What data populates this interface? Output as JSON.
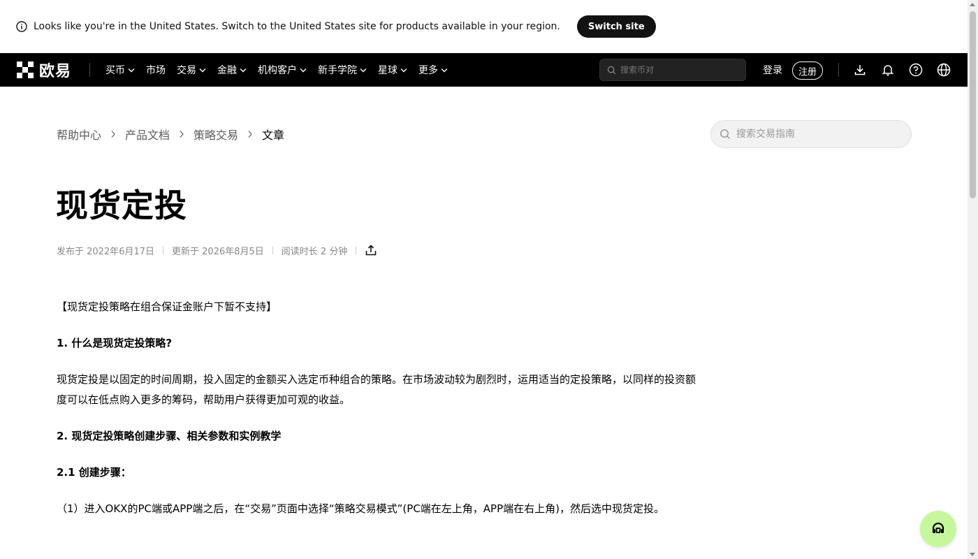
{
  "banner": {
    "message": "Looks like you're in the United States. Switch to the United States site for products available in your region.",
    "switch_label": "Switch site"
  },
  "nav": {
    "brand": "欧易",
    "items": [
      {
        "label": "买币",
        "dropdown": true
      },
      {
        "label": "市场",
        "dropdown": false
      },
      {
        "label": "交易",
        "dropdown": true
      },
      {
        "label": "金融",
        "dropdown": true
      },
      {
        "label": "机构客户",
        "dropdown": true
      },
      {
        "label": "新手学院",
        "dropdown": true
      },
      {
        "label": "星球",
        "dropdown": true
      },
      {
        "label": "更多",
        "dropdown": true
      }
    ],
    "search_placeholder": "搜索币对",
    "login_label": "登录",
    "register_label": "注册",
    "icons": [
      "download-icon",
      "bell-icon",
      "help-icon",
      "globe-icon"
    ]
  },
  "breadcrumb": {
    "items": [
      "帮助中心",
      "产品文档",
      "策略交易",
      "文章"
    ]
  },
  "guide_search": {
    "placeholder": "搜索交易指南"
  },
  "article": {
    "title": "现货定投",
    "published": "发布于 2022年6月17日",
    "updated": "更新于 2026年8月5日",
    "read_time": "阅读时长 2 分钟",
    "paragraphs": [
      {
        "text": "【现货定投策略在组合保证金账户下暂不支持】",
        "bold": false
      },
      {
        "text": "1. 什么是现货定投策略?",
        "bold": true
      },
      {
        "text": "现货定投是以固定的时间周期，投入固定的金额买入选定币种组合的策略。在市场波动较为剧烈时，运用适当的定投策略，以同样的投资额度可以在低点购入更多的筹码，帮助用户获得更加可观的收益。",
        "bold": false
      },
      {
        "text": "2. 现货定投策略创建步骤、相关参数和实例教学",
        "bold": true
      },
      {
        "text": "2.1 创建步骤：",
        "bold": true
      },
      {
        "text": "（1）进入OKX的PC端或APP端之后，在“交易”页面中选择“策略交易模式”(PC端在左上角，APP端在右上角)，然后选中现货定投。",
        "bold": false
      }
    ]
  },
  "colors": {
    "nav_bg": "#000000",
    "support_bg": "#c6f79d",
    "switch_btn_bg": "#121212"
  }
}
